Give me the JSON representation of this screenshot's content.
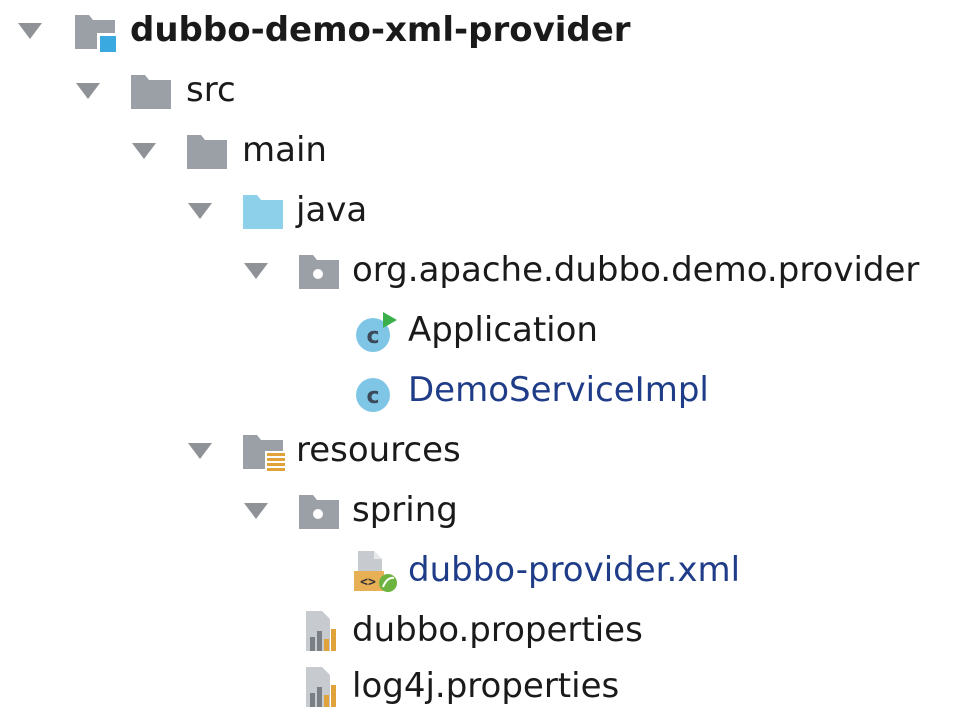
{
  "tree": {
    "root": {
      "label": "dubbo-demo-xml-provider",
      "icon": "module-folder-icon",
      "expanded": true
    },
    "src": {
      "label": "src",
      "icon": "folder-icon",
      "expanded": true
    },
    "main": {
      "label": "main",
      "icon": "folder-icon",
      "expanded": true
    },
    "java": {
      "label": "java",
      "icon": "source-root-folder-icon",
      "expanded": true
    },
    "package": {
      "label": "org.apache.dubbo.demo.provider",
      "icon": "package-icon",
      "expanded": true
    },
    "application": {
      "label": "Application",
      "icon": "runnable-class-icon"
    },
    "demoServiceImpl": {
      "label": "DemoServiceImpl",
      "icon": "class-icon"
    },
    "resources": {
      "label": "resources",
      "icon": "resources-folder-icon",
      "expanded": true
    },
    "spring": {
      "label": "spring",
      "icon": "package-icon",
      "expanded": true
    },
    "providerXml": {
      "label": "dubbo-provider.xml",
      "icon": "spring-xml-file-icon"
    },
    "dubboProperties": {
      "label": "dubbo.properties",
      "icon": "properties-file-icon"
    },
    "log4jProperties": {
      "label": "log4j.properties",
      "icon": "properties-file-icon"
    }
  },
  "colors": {
    "arrow": "#8f9297",
    "folder": "#9aa0a6",
    "source_folder": "#8dd0ea",
    "class_icon": "#7fc6e6",
    "modified_text": "#1f3c88"
  }
}
